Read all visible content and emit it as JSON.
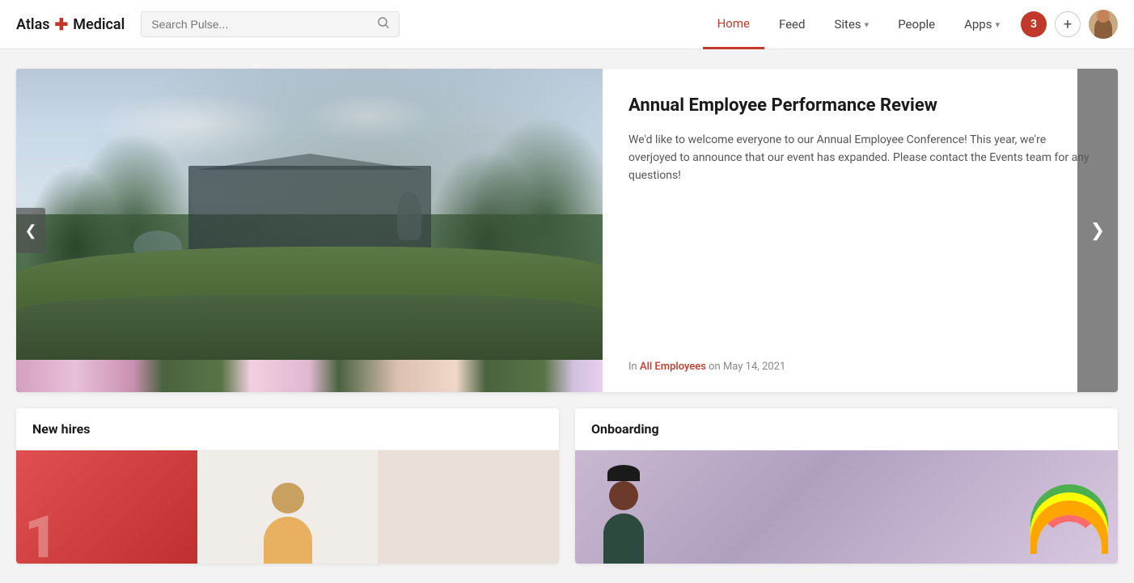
{
  "logo": {
    "name": "Atlas",
    "cross": "✚",
    "subtitle": "Medical"
  },
  "search": {
    "placeholder": "Search Pulse..."
  },
  "nav": {
    "items": [
      {
        "label": "Home",
        "active": true,
        "hasDropdown": false
      },
      {
        "label": "Feed",
        "active": false,
        "hasDropdown": false
      },
      {
        "label": "Sites",
        "active": false,
        "hasDropdown": true
      },
      {
        "label": "People",
        "active": false,
        "hasDropdown": false
      },
      {
        "label": "Apps",
        "active": false,
        "hasDropdown": true
      }
    ]
  },
  "header": {
    "notif_count": "3",
    "plus_icon": "+",
    "prev_icon": "❮",
    "next_icon": "❯"
  },
  "hero": {
    "title": "Annual Employee Performance Review",
    "body": "We'd like to welcome everyone to our Annual Employee Conference! This year, we're overjoyed to announce that our event has expanded. Please contact the Events team for any questions!",
    "meta_prefix": "In",
    "meta_link": "All Employees",
    "meta_suffix": "on May 14, 2021",
    "prev_label": "❮",
    "next_label": "❯"
  },
  "sections": {
    "new_hires": {
      "title": "New hires",
      "thumb1_num": "1"
    },
    "onboarding": {
      "title": "Onboarding"
    }
  },
  "icons": {
    "search": "○",
    "chevron_down": "∨"
  }
}
